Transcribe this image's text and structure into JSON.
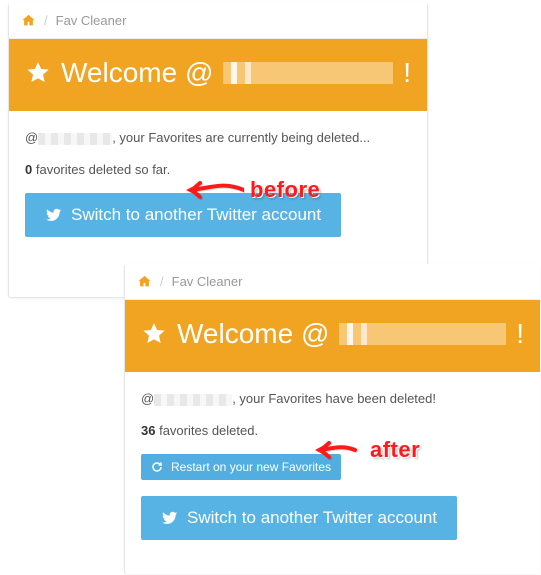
{
  "breadcrumb": {
    "sep": "/",
    "current": "Fav Cleaner"
  },
  "hero": {
    "welcome_prefix": "Welcome @",
    "bang": "!"
  },
  "before": {
    "status_prefix": "@",
    "status_suffix": ", your Favorites are currently being deleted...",
    "count": "0",
    "count_suffix": " favorites deleted so far.",
    "switch_label": "Switch to another Twitter account"
  },
  "after": {
    "status_prefix": "@",
    "status_suffix": ", your Favorites have been deleted!",
    "count": "36",
    "count_suffix": " favorites deleted.",
    "restart_label": "Restart on your new Favorites",
    "switch_label": "Switch to another Twitter account"
  },
  "callouts": {
    "before": "before",
    "after": "after"
  }
}
